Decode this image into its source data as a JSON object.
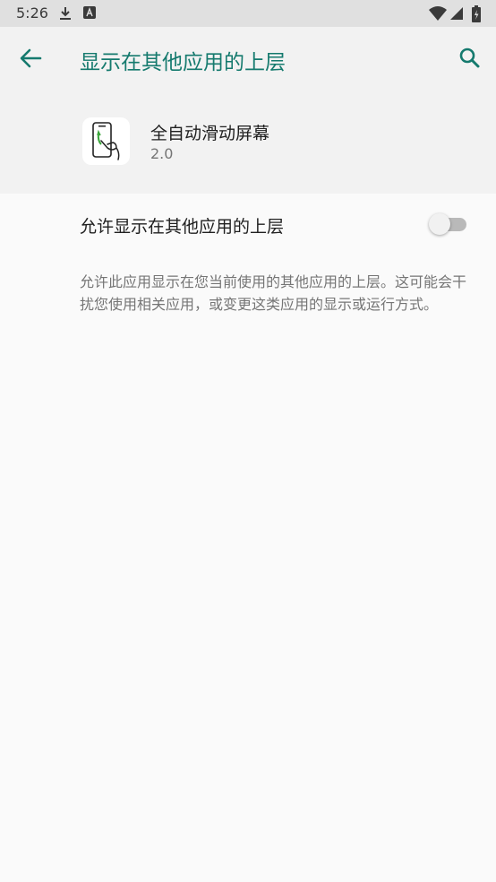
{
  "status_bar": {
    "time": "5:26",
    "icons": [
      "download-icon",
      "text-badge-icon",
      "wifi-icon",
      "signal-icon",
      "battery-icon"
    ]
  },
  "app_bar": {
    "title": "显示在其他应用的上层",
    "back_icon": "arrow-left-icon",
    "search_icon": "search-icon"
  },
  "app_info": {
    "name": "全自动滑动屏幕",
    "version": "2.0",
    "icon": "phone-hand-icon"
  },
  "preference": {
    "label": "允许显示在其他应用的上层",
    "enabled": false,
    "summary": "允许此应用显示在您当前使用的其他应用的上层。这可能会干扰您使用相关应用，或变更这类应用的显示或运行方式。"
  },
  "colors": {
    "accent": "#157a6e",
    "status_bar_bg": "#e0e0e0",
    "header_bg": "#f2f2f2",
    "page_bg": "#fafafa"
  }
}
